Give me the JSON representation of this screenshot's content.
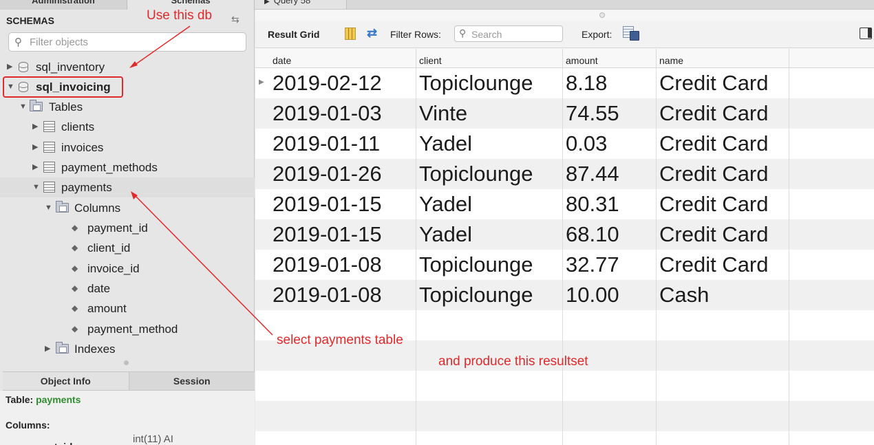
{
  "top_tabs": {
    "left": "Administration",
    "right": "Schemas"
  },
  "query_tab": {
    "label": "Query 58"
  },
  "sidebar": {
    "header": "SCHEMAS",
    "filter_placeholder": "Filter objects",
    "tree": {
      "db1": "sql_inventory",
      "db2": "sql_invoicing",
      "tables_folder": "Tables",
      "t_clients": "clients",
      "t_invoices": "invoices",
      "t_payment_methods": "payment_methods",
      "t_payments": "payments",
      "columns_folder": "Columns",
      "columns": [
        "payment_id",
        "client_id",
        "invoice_id",
        "date",
        "amount",
        "payment_method"
      ],
      "indexes_folder": "Indexes"
    },
    "info_tabs": {
      "object_info": "Object Info",
      "session": "Session"
    },
    "object_info": {
      "table_label": "Table:",
      "table_name": "payments",
      "columns_label": "Columns:",
      "first_column": "payment_id",
      "first_column_type": "int(11) AI"
    }
  },
  "toolbar": {
    "result_grid": "Result Grid",
    "filter_rows": "Filter Rows:",
    "search_placeholder": "Search",
    "export": "Export:"
  },
  "grid": {
    "columns": [
      "date",
      "client",
      "amount",
      "name"
    ],
    "rows": [
      [
        "2019-02-12",
        "Topiclounge",
        "8.18",
        "Credit Card"
      ],
      [
        "2019-01-03",
        "Vinte",
        "74.55",
        "Credit Card"
      ],
      [
        "2019-01-11",
        "Yadel",
        "0.03",
        "Credit Card"
      ],
      [
        "2019-01-26",
        "Topiclounge",
        "87.44",
        "Credit Card"
      ],
      [
        "2019-01-15",
        "Yadel",
        "80.31",
        "Credit Card"
      ],
      [
        "2019-01-15",
        "Yadel",
        "68.10",
        "Credit Card"
      ],
      [
        "2019-01-08",
        "Topiclounge",
        "32.77",
        "Credit Card"
      ],
      [
        "2019-01-08",
        "Topiclounge",
        "10.00",
        "Cash"
      ]
    ]
  },
  "annotations": {
    "use_db": "Use this db",
    "select_table": "select payments table",
    "produce": "and produce this resultset"
  },
  "colors": {
    "annotation": "#e0292b",
    "table_name_green": "#2f8c2f"
  }
}
